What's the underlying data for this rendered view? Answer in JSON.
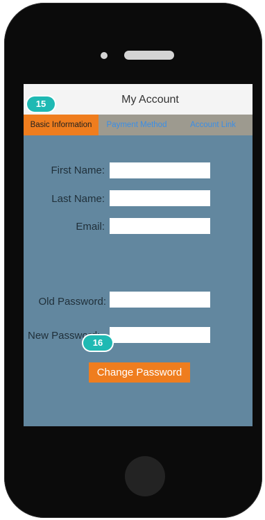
{
  "header": {
    "title": "My Account"
  },
  "tabs": [
    {
      "label": "Basic Information",
      "active": true
    },
    {
      "label": "Payment Method",
      "active": false
    },
    {
      "label": "Account Link",
      "active": false
    }
  ],
  "form": {
    "first_name_label": "First Name:",
    "last_name_label": "Last Name:",
    "email_label": "Email:",
    "old_password_label": "Old Password:",
    "new_password_label": "New Password:",
    "first_name_value": "",
    "last_name_value": "",
    "email_value": "",
    "old_password_value": "",
    "new_password_value": "",
    "change_password_label": "Change Password"
  },
  "markers": {
    "m1": "15",
    "m2": "16"
  },
  "colors": {
    "screen_bg": "#62879f",
    "accent": "#ef7d1e",
    "tab_link": "#3a8ee6",
    "marker": "#1fb9b3",
    "phone_body": "#0b0b0b"
  }
}
